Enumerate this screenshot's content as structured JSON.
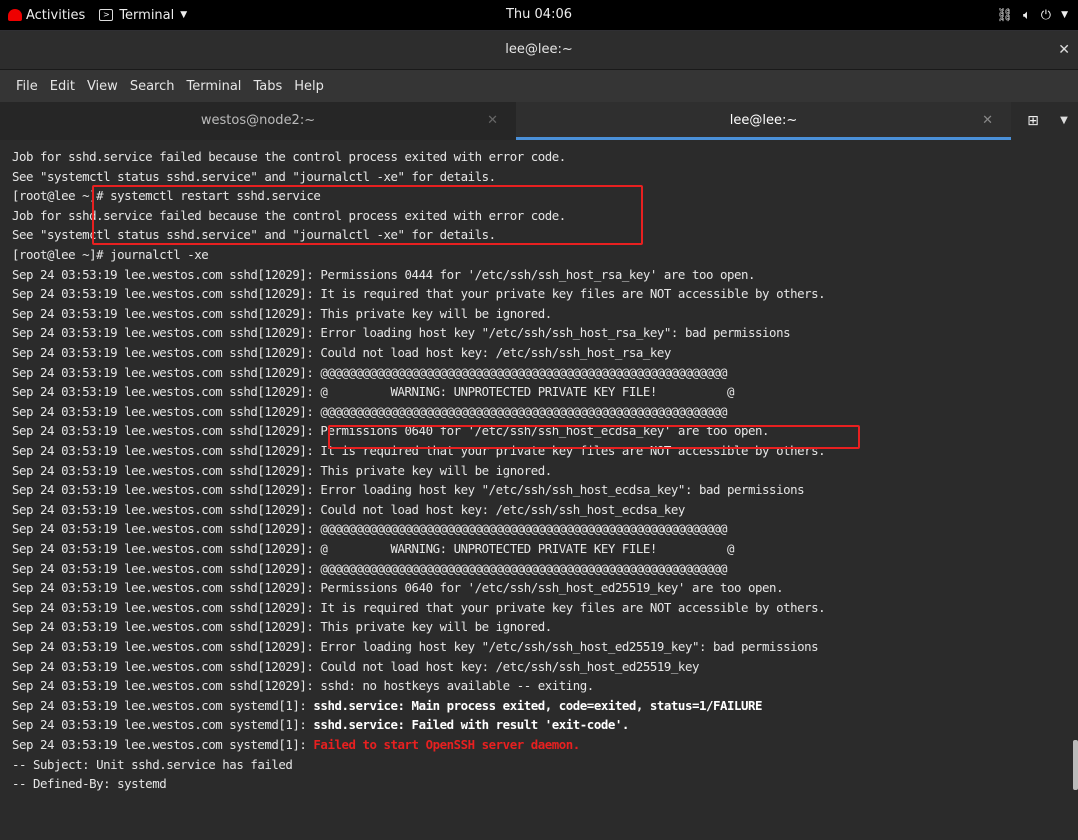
{
  "topbar": {
    "activities": "Activities",
    "app_menu": "Terminal",
    "clock": "Thu 04:06"
  },
  "window": {
    "title": "lee@lee:~",
    "menu": [
      "File",
      "Edit",
      "View",
      "Search",
      "Terminal",
      "Tabs",
      "Help"
    ],
    "tabs": [
      {
        "label": "westos@node2:~",
        "active": false
      },
      {
        "label": "lee@lee:~",
        "active": true
      }
    ]
  },
  "terminal": {
    "lines": [
      {
        "text": "Job for sshd.service failed because the control process exited with error code."
      },
      {
        "text": "See \"systemctl status sshd.service\" and \"journalctl -xe\" for details."
      },
      {
        "text": "[root@lee ~]# systemctl restart sshd.service"
      },
      {
        "text": "Job for sshd.service failed because the control process exited with error code."
      },
      {
        "text": "See \"systemctl status sshd.service\" and \"journalctl -xe\" for details."
      },
      {
        "text": "[root@lee ~]# journalctl -xe"
      },
      {
        "text": "Sep 24 03:53:19 lee.westos.com sshd[12029]: Permissions 0444 for '/etc/ssh/ssh_host_rsa_key' are too open."
      },
      {
        "text": "Sep 24 03:53:19 lee.westos.com sshd[12029]: It is required that your private key files are NOT accessible by others."
      },
      {
        "text": "Sep 24 03:53:19 lee.westos.com sshd[12029]: This private key will be ignored."
      },
      {
        "text": "Sep 24 03:53:19 lee.westos.com sshd[12029]: Error loading host key \"/etc/ssh/ssh_host_rsa_key\": bad permissions"
      },
      {
        "text": "Sep 24 03:53:19 lee.westos.com sshd[12029]: Could not load host key: /etc/ssh/ssh_host_rsa_key"
      },
      {
        "text": "Sep 24 03:53:19 lee.westos.com sshd[12029]: @@@@@@@@@@@@@@@@@@@@@@@@@@@@@@@@@@@@@@@@@@@@@@@@@@@@@@@@@@"
      },
      {
        "text": "Sep 24 03:53:19 lee.westos.com sshd[12029]: @         WARNING: UNPROTECTED PRIVATE KEY FILE!          @"
      },
      {
        "text": "Sep 24 03:53:19 lee.westos.com sshd[12029]: @@@@@@@@@@@@@@@@@@@@@@@@@@@@@@@@@@@@@@@@@@@@@@@@@@@@@@@@@@"
      },
      {
        "text": "Sep 24 03:53:19 lee.westos.com sshd[12029]: Permissions 0640 for '/etc/ssh/ssh_host_ecdsa_key' are too open."
      },
      {
        "text": "Sep 24 03:53:19 lee.westos.com sshd[12029]: It is required that your private key files are NOT accessible by others."
      },
      {
        "text": "Sep 24 03:53:19 lee.westos.com sshd[12029]: This private key will be ignored."
      },
      {
        "text": "Sep 24 03:53:19 lee.westos.com sshd[12029]: Error loading host key \"/etc/ssh/ssh_host_ecdsa_key\": bad permissions"
      },
      {
        "text": "Sep 24 03:53:19 lee.westos.com sshd[12029]: Could not load host key: /etc/ssh/ssh_host_ecdsa_key"
      },
      {
        "text": "Sep 24 03:53:19 lee.westos.com sshd[12029]: @@@@@@@@@@@@@@@@@@@@@@@@@@@@@@@@@@@@@@@@@@@@@@@@@@@@@@@@@@"
      },
      {
        "text": "Sep 24 03:53:19 lee.westos.com sshd[12029]: @         WARNING: UNPROTECTED PRIVATE KEY FILE!          @"
      },
      {
        "text": "Sep 24 03:53:19 lee.westos.com sshd[12029]: @@@@@@@@@@@@@@@@@@@@@@@@@@@@@@@@@@@@@@@@@@@@@@@@@@@@@@@@@@"
      },
      {
        "text": "Sep 24 03:53:19 lee.westos.com sshd[12029]: Permissions 0640 for '/etc/ssh/ssh_host_ed25519_key' are too open."
      },
      {
        "text": "Sep 24 03:53:19 lee.westos.com sshd[12029]: It is required that your private key files are NOT accessible by others."
      },
      {
        "text": "Sep 24 03:53:19 lee.westos.com sshd[12029]: This private key will be ignored."
      },
      {
        "text": "Sep 24 03:53:19 lee.westos.com sshd[12029]: Error loading host key \"/etc/ssh/ssh_host_ed25519_key\": bad permissions"
      },
      {
        "text": "Sep 24 03:53:19 lee.westos.com sshd[12029]: Could not load host key: /etc/ssh/ssh_host_ed25519_key"
      },
      {
        "text": "Sep 24 03:53:19 lee.westos.com sshd[12029]: sshd: no hostkeys available -- exiting."
      },
      {
        "prefix": "Sep 24 03:53:19 lee.westos.com systemd[1]: ",
        "emph": "sshd.service: Main process exited, code=exited, status=1/FAILURE",
        "style": "bold"
      },
      {
        "prefix": "Sep 24 03:53:19 lee.westos.com systemd[1]: ",
        "emph": "sshd.service: Failed with result 'exit-code'.",
        "style": "bold"
      },
      {
        "prefix": "Sep 24 03:53:19 lee.westos.com systemd[1]: ",
        "emph": "Failed to start OpenSSH server daemon.",
        "style": "red"
      },
      {
        "text": "-- Subject: Unit sshd.service has failed"
      },
      {
        "text": "-- Defined-By: systemd"
      }
    ]
  },
  "colors": {
    "highlight": "#e82020",
    "terminal_bg": "#2b2b2b",
    "terminal_fg": "#e6e6e6",
    "active_tab_accent": "#4a90d9"
  },
  "icons": [
    "redhat-logo-icon",
    "terminal-icon",
    "network-icon",
    "volume-icon",
    "power-icon",
    "close-icon",
    "new-tab-icon",
    "tab-menu-icon"
  ]
}
